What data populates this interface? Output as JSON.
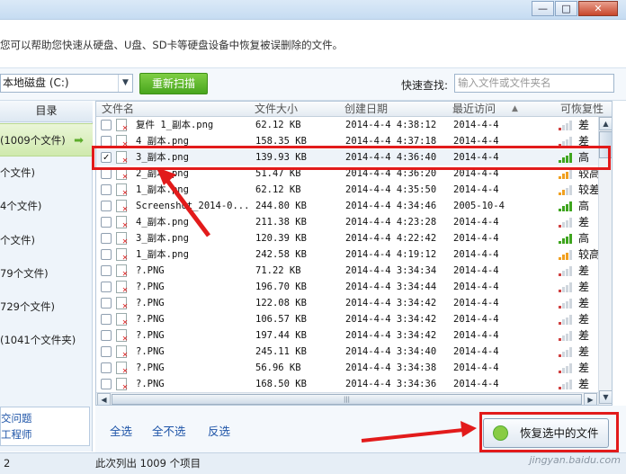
{
  "info": {
    "text": "您可以帮助您快速从硬盘、U盘、SD卡等硬盘设备中恢复被误删除的文件。"
  },
  "toolbar": {
    "drive_value": "本地磁盘 (C:)",
    "rescan_label": "重新扫描",
    "quick_search_label": "快速查找:",
    "quick_search_placeholder": "输入文件或文件夹名"
  },
  "sidebar": {
    "header": "目录",
    "items": [
      {
        "label": "(1009个文件)"
      },
      {
        "label": "个文件)"
      },
      {
        "label": "4个文件)"
      },
      {
        "label": "个文件)"
      },
      {
        "label": "79个文件)"
      },
      {
        "label": "729个文件)"
      },
      {
        "label": "(1041个文件夹)"
      }
    ],
    "help_line1": "交问题",
    "help_line2": "工程师"
  },
  "table": {
    "columns": {
      "name": "文件名",
      "size": "文件大小",
      "created": "创建日期",
      "accessed": "最近访问",
      "recover": "可恢复性"
    },
    "rows": [
      {
        "name": "复件 1_副本.png",
        "size": "62.12 KB",
        "created": "2014-4-4 4:38:12",
        "accessed": "2014-4-4",
        "level": 1,
        "recover": "差",
        "checked": false
      },
      {
        "name": "4_副本.png",
        "size": "158.35 KB",
        "created": "2014-4-4 4:37:18",
        "accessed": "2014-4-4",
        "level": 1,
        "recover": "差",
        "checked": false
      },
      {
        "name": "3_副本.png",
        "size": "139.93 KB",
        "created": "2014-4-4 4:36:40",
        "accessed": "2014-4-4",
        "level": 4,
        "recover": "高",
        "checked": true
      },
      {
        "name": "2_副本.png",
        "size": "51.47 KB",
        "created": "2014-4-4 4:36:20",
        "accessed": "2014-4-4",
        "level": 3,
        "recover": "较高",
        "checked": false
      },
      {
        "name": "1_副本.png",
        "size": "62.12 KB",
        "created": "2014-4-4 4:35:50",
        "accessed": "2014-4-4",
        "level": 2,
        "recover": "较差",
        "checked": false
      },
      {
        "name": "Screenshot_2014-0...",
        "size": "244.80 KB",
        "created": "2014-4-4 4:34:46",
        "accessed": "2005-10-4",
        "level": 4,
        "recover": "高",
        "checked": false
      },
      {
        "name": "4_副本.png",
        "size": "211.38 KB",
        "created": "2014-4-4 4:23:28",
        "accessed": "2014-4-4",
        "level": 1,
        "recover": "差",
        "checked": false
      },
      {
        "name": "3_副本.png",
        "size": "120.39 KB",
        "created": "2014-4-4 4:22:42",
        "accessed": "2014-4-4",
        "level": 4,
        "recover": "高",
        "checked": false
      },
      {
        "name": "1_副本.png",
        "size": "242.58 KB",
        "created": "2014-4-4 4:19:12",
        "accessed": "2014-4-4",
        "level": 3,
        "recover": "较高",
        "checked": false
      },
      {
        "name": "?.PNG",
        "size": "71.22 KB",
        "created": "2014-4-4 3:34:34",
        "accessed": "2014-4-4",
        "level": 1,
        "recover": "差",
        "checked": false
      },
      {
        "name": "?.PNG",
        "size": "196.70 KB",
        "created": "2014-4-4 3:34:44",
        "accessed": "2014-4-4",
        "level": 1,
        "recover": "差",
        "checked": false
      },
      {
        "name": "?.PNG",
        "size": "122.08 KB",
        "created": "2014-4-4 3:34:42",
        "accessed": "2014-4-4",
        "level": 1,
        "recover": "差",
        "checked": false
      },
      {
        "name": "?.PNG",
        "size": "106.57 KB",
        "created": "2014-4-4 3:34:42",
        "accessed": "2014-4-4",
        "level": 1,
        "recover": "差",
        "checked": false
      },
      {
        "name": "?.PNG",
        "size": "197.44 KB",
        "created": "2014-4-4 3:34:42",
        "accessed": "2014-4-4",
        "level": 1,
        "recover": "差",
        "checked": false
      },
      {
        "name": "?.PNG",
        "size": "245.11 KB",
        "created": "2014-4-4 3:34:40",
        "accessed": "2014-4-4",
        "level": 1,
        "recover": "差",
        "checked": false
      },
      {
        "name": "?.PNG",
        "size": "56.96 KB",
        "created": "2014-4-4 3:34:38",
        "accessed": "2014-4-4",
        "level": 1,
        "recover": "差",
        "checked": false
      },
      {
        "name": "?.PNG",
        "size": "168.50 KB",
        "created": "2014-4-4 3:34:36",
        "accessed": "2014-4-4",
        "level": 1,
        "recover": "差",
        "checked": false
      }
    ]
  },
  "bottom": {
    "select_all": "全选",
    "select_none": "全不选",
    "invert": "反选",
    "recover_label": "恢复选中的文件"
  },
  "status": {
    "left_num": "2",
    "text": "此次列出 1009 个项目"
  },
  "watermark": "jingyan.baidu.com",
  "window": {
    "minimize": "—",
    "restore": "□",
    "close": "✕"
  },
  "colors": {
    "accent_green": "#5cb82e",
    "annotation_red": "#e21b1b",
    "signal_high": "#3fa51f",
    "signal_mid": "#f0a020",
    "signal_low": "#d04040"
  },
  "icons": {
    "sort": "sort-up-icon",
    "file": "deleted-file-icon",
    "arrow": "green-arrow-icon"
  }
}
